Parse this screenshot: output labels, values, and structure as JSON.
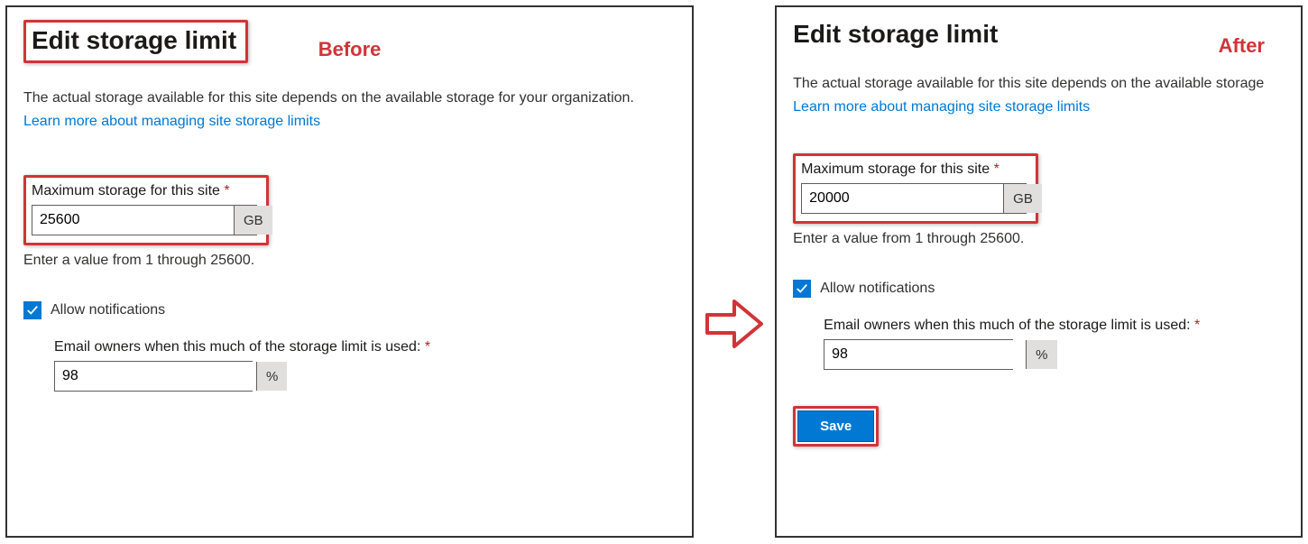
{
  "labels": {
    "before": "Before",
    "after": "After"
  },
  "before": {
    "title": "Edit storage limit",
    "description": "The actual storage available for this site depends on the available storage for your organization.",
    "link": "Learn more about managing site storage limits",
    "max_label": "Maximum storage for this site",
    "max_value": "25600",
    "unit": "GB",
    "hint": "Enter a value from 1 through 25600.",
    "allow_notifications": "Allow notifications",
    "email_label": "Email owners when this much of the storage limit is used:",
    "email_value": "98",
    "percent": "%"
  },
  "after": {
    "title": "Edit storage limit",
    "description": "The actual storage available for this site depends on the available storage",
    "link": "Learn more about managing site storage limits",
    "max_label": "Maximum storage for this site",
    "max_value": "20000",
    "unit": "GB",
    "hint": "Enter a value from 1 through 25600.",
    "allow_notifications": "Allow notifications",
    "email_label": "Email owners when this much of the storage limit is used:",
    "email_value": "98",
    "percent": "%",
    "save": "Save"
  }
}
